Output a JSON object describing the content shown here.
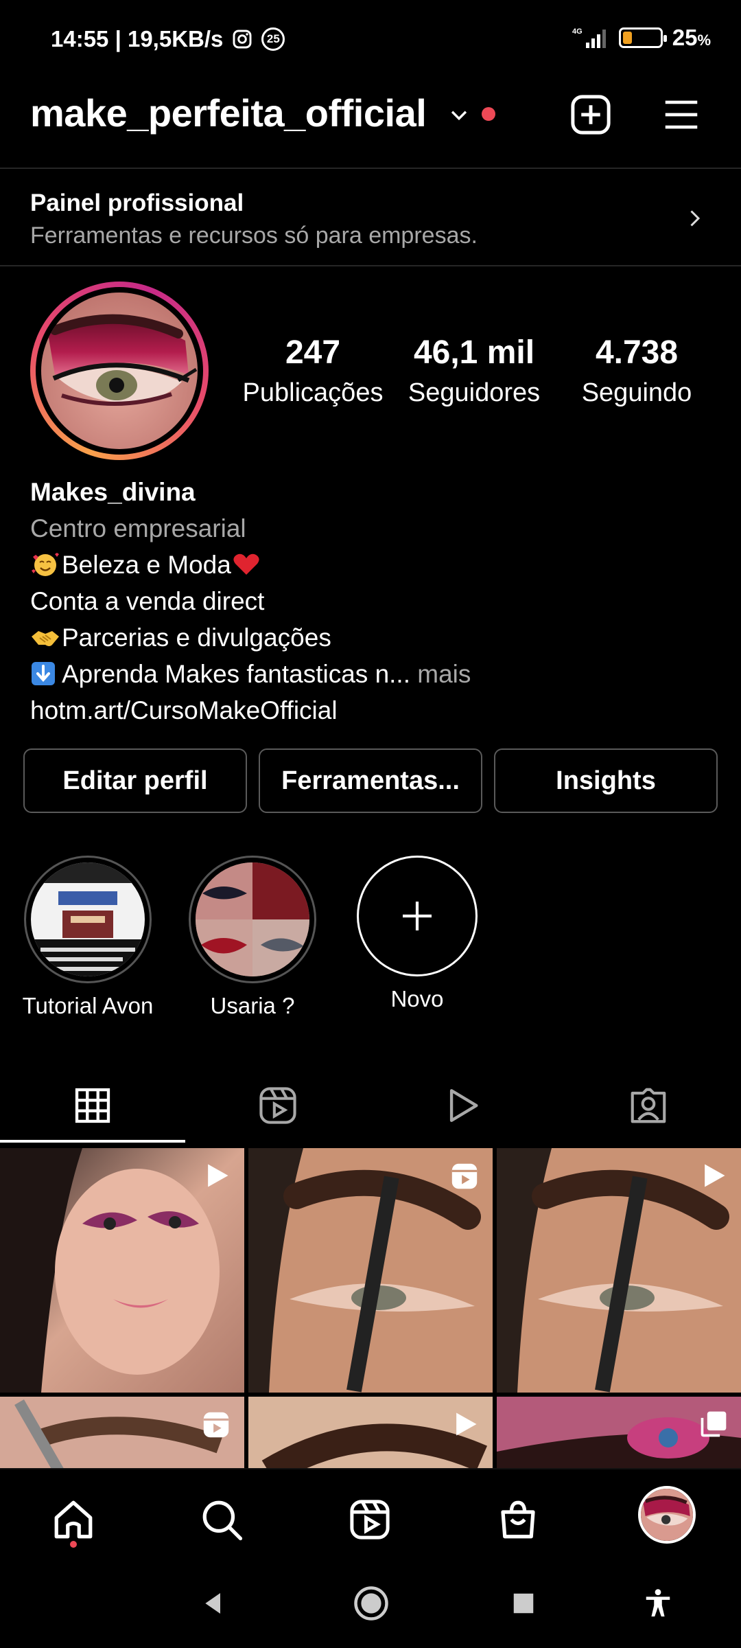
{
  "status_bar": {
    "time_speed": "14:55 | 19,5KB/s",
    "notif_count": "25",
    "network": "4G",
    "battery": "25",
    "battery_unit": "%",
    "battery_level": 0.25
  },
  "header": {
    "username": "make_perfeita_official",
    "has_notification_dot": true
  },
  "professional_panel": {
    "title": "Painel profissional",
    "subtitle": "Ferramentas e recursos só para empresas."
  },
  "profile": {
    "stats": [
      {
        "value": "247",
        "label": "Publicações"
      },
      {
        "value": "46,1 mil",
        "label": "Seguidores"
      },
      {
        "value": "4.738",
        "label": "Seguindo"
      }
    ],
    "display_name": "Makes_divina",
    "category": "Centro empresarial",
    "bio_lines": [
      "Beleza e Moda",
      "Conta a venda direct",
      "Parcerias e divulgações",
      "Aprenda Makes fantasticas n..."
    ],
    "more_label": "mais",
    "link": "hotm.art/CursoMakeOfficial"
  },
  "actions": {
    "edit": "Editar perfil",
    "tools": "Ferramentas...",
    "insights": "Insights"
  },
  "highlights": [
    {
      "label": "Tutorial Avon"
    },
    {
      "label": "Usaria ?"
    },
    {
      "label": "Novo"
    }
  ],
  "tabs": [
    "grid-icon",
    "reels-icon",
    "video-icon",
    "tagged-icon"
  ],
  "grid": {
    "rows": [
      [
        {
          "badge": "play-icon"
        },
        {
          "badge": "reels-icon"
        },
        {
          "badge": "play-icon"
        }
      ],
      [
        {
          "badge": "reels-icon"
        },
        {
          "badge": "play-icon"
        },
        {
          "badge": "carousel-icon"
        }
      ]
    ]
  },
  "colors": {
    "background": "#000000",
    "accent_red": "#ed4956",
    "secondary_text": "#a8a8a8",
    "border": "#5a5a5a"
  }
}
